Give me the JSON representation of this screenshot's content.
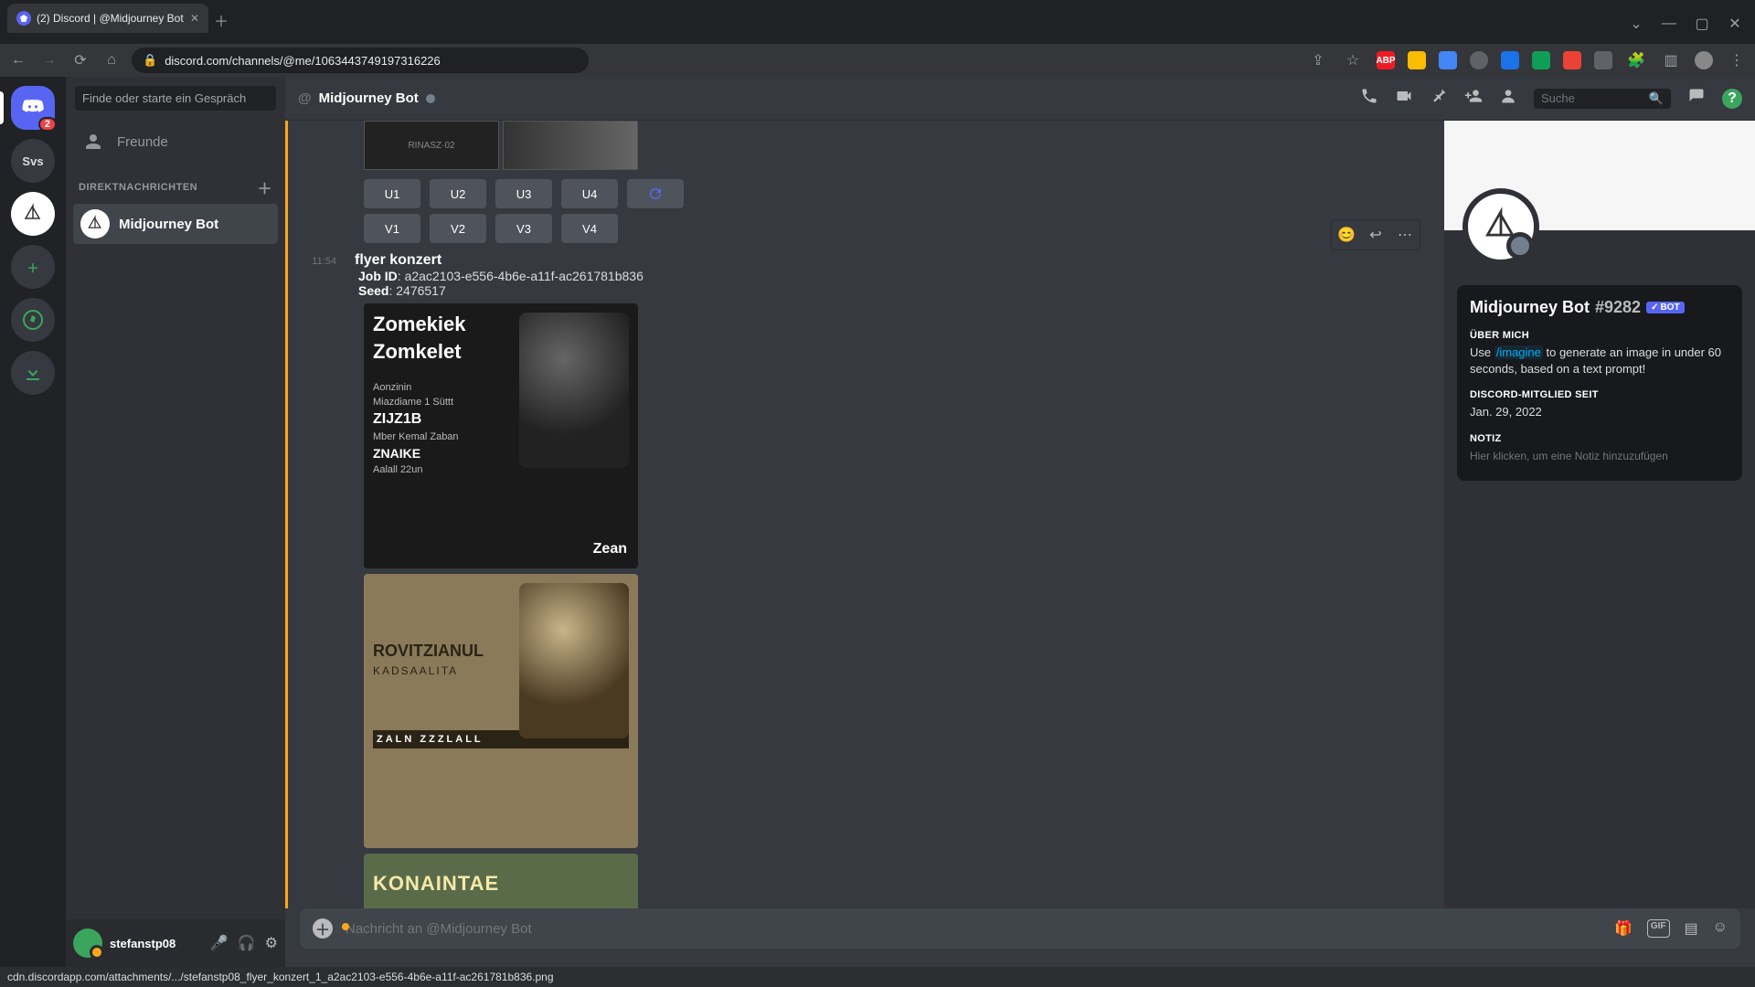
{
  "browser": {
    "tab_title": "(2) Discord | @Midjourney Bot",
    "url": "discord.com/channels/@me/1063443749197316226",
    "ext": {
      "abp": "ABP"
    }
  },
  "rail": {
    "svs": "Svs"
  },
  "sidebar": {
    "search_placeholder": "Finde oder starte ein Gespräch",
    "friends": "Freunde",
    "dm_header": "DIREKTNACHRICHTEN",
    "dm_item": "Midjourney Bot"
  },
  "user": {
    "name": "stefanstp08"
  },
  "header": {
    "title": "Midjourney Bot",
    "search_placeholder": "Suche"
  },
  "buttons": {
    "u1": "U1",
    "u2": "U2",
    "u3": "U3",
    "u4": "U4",
    "v1": "V1",
    "v2": "V2",
    "v3": "V3",
    "v4": "V4"
  },
  "message": {
    "time": "11:54",
    "title": "flyer konzert",
    "jobid_label": "Job ID",
    "jobid": "a2ac2103-e556-4b6e-a11f-ac261781b836",
    "seed_label": "Seed",
    "seed": "2476517",
    "img1": {
      "l1": "Zomekiek",
      "l2": "Zomkelet",
      "l3": "Aonzinin",
      "l4": "Miazdiame 1 Süttt",
      "l5": "ZIJZ1B",
      "l6": "Mber Kemal Zaban",
      "l7": "ZNAIKE",
      "l8": "Aalall 22un",
      "brand": "Zean"
    },
    "img2": {
      "l1": "ROVITZIANUL",
      "l2": "KADSAALITA",
      "l3": "ZALN ZZZLALL"
    },
    "img3": {
      "l1": "KONAINTAE"
    }
  },
  "input": {
    "placeholder": "Nachricht an @Midjourney Bot"
  },
  "profile": {
    "name": "Midjourney Bot",
    "disc": "#9282",
    "bot": "BOT",
    "about_head": "ÜBER MICH",
    "about_pre": "Use ",
    "about_cmd": "/imagine",
    "about_post": " to generate an image in under 60 seconds, based on a text prompt!",
    "since_head": "DISCORD-MITGLIED SEIT",
    "since": "Jan. 29, 2022",
    "note_head": "NOTIZ",
    "note_placeholder": "Hier klicken, um eine Notiz hinzuzufügen"
  },
  "status": "cdn.discordapp.com/attachments/.../stefanstp08_flyer_konzert_1_a2ac2103-e556-4b6e-a11f-ac261781b836.png"
}
